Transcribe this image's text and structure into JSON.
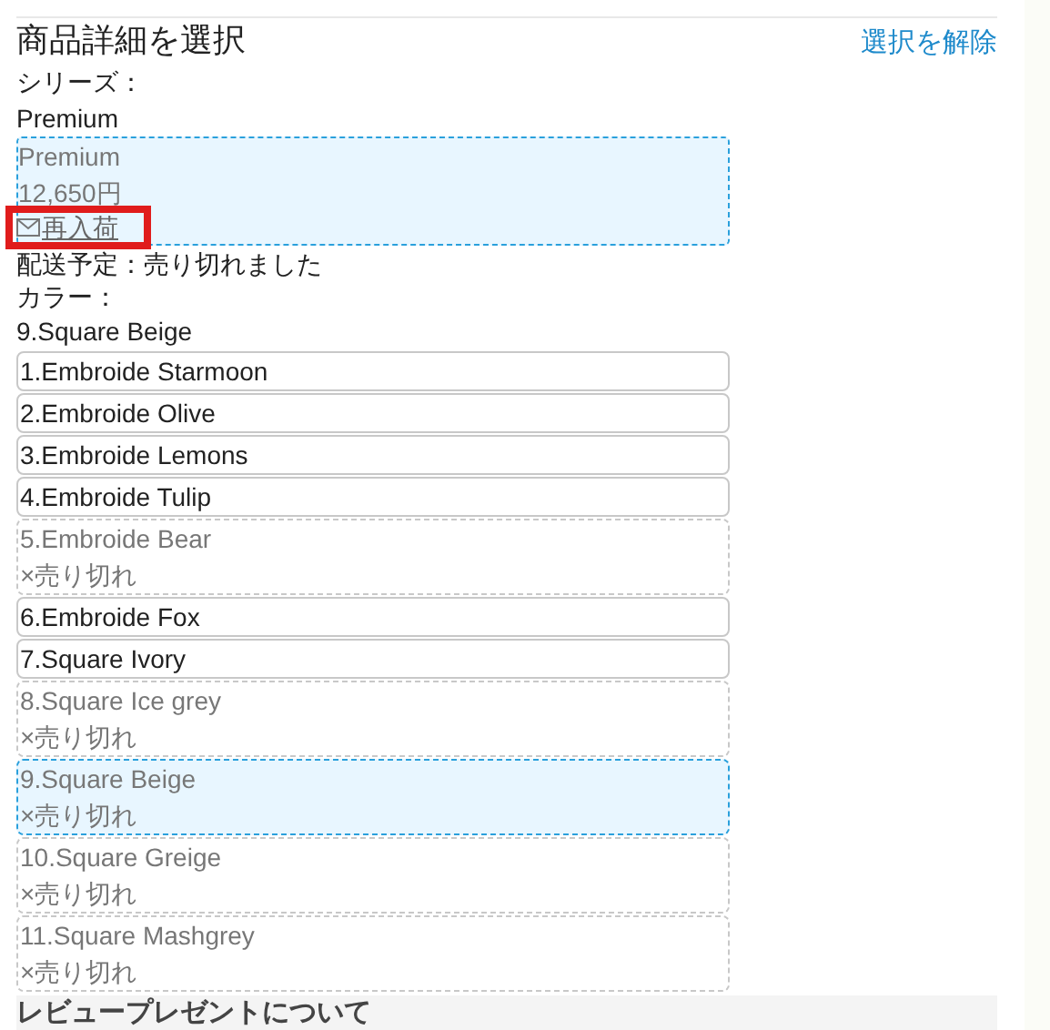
{
  "header": {
    "title": "商品詳細を選択",
    "clear_link": "選択を解除"
  },
  "series": {
    "label": "シリーズ：",
    "value": "Premium",
    "options": [
      {
        "name": "Premium",
        "price": "12,650円",
        "restock_link": "再入荷",
        "selected": true,
        "sold_out": true
      }
    ]
  },
  "delivery": "配送予定：売り切れました",
  "color": {
    "label": "カラー：",
    "value": "9.Square Beige",
    "options": [
      {
        "name": "1.Embroide Starmoon",
        "sold_out": false,
        "selected": false
      },
      {
        "name": "2.Embroide Olive",
        "sold_out": false,
        "selected": false
      },
      {
        "name": "3.Embroide Lemons",
        "sold_out": false,
        "selected": false
      },
      {
        "name": "4.Embroide Tulip",
        "sold_out": false,
        "selected": false
      },
      {
        "name": "5.Embroide Bear",
        "sold_out": true,
        "status": "×売り切れ",
        "selected": false
      },
      {
        "name": "6.Embroide Fox",
        "sold_out": false,
        "selected": false
      },
      {
        "name": "7.Square Ivory",
        "sold_out": false,
        "selected": false
      },
      {
        "name": "8.Square Ice grey",
        "sold_out": true,
        "status": "×売り切れ",
        "selected": false
      },
      {
        "name": "9.Square Beige",
        "sold_out": true,
        "status": "×売り切れ",
        "selected": true
      },
      {
        "name": "10.Square Greige",
        "sold_out": true,
        "status": "×売り切れ",
        "selected": false
      },
      {
        "name": "11.Square Mashgrey",
        "sold_out": true,
        "status": "×売り切れ",
        "selected": false
      }
    ]
  },
  "next_section": {
    "title": "レビュープレゼントについて"
  }
}
